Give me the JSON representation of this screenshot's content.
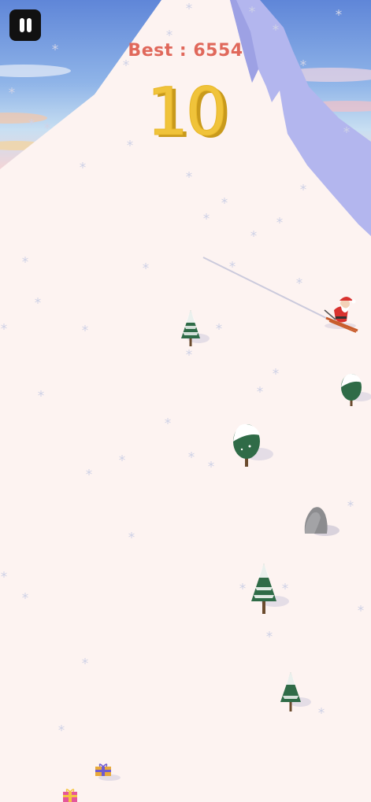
{
  "hud": {
    "best_label": "Best : 6554",
    "score": "10"
  },
  "icons": {
    "pause": "pause-icon"
  },
  "colors": {
    "snow": "#fdf3f1",
    "mountain_shadow": "#b3b6ee",
    "best_text": "#e0685b",
    "score_text": "#f0c33a",
    "tree_green": "#2f6b47"
  },
  "objects": {
    "player": "santa-skier",
    "obstacles": [
      "pine-tree",
      "round-tree",
      "boulder"
    ],
    "pickups": [
      "gift-box-gold",
      "gift-box-pink"
    ]
  }
}
